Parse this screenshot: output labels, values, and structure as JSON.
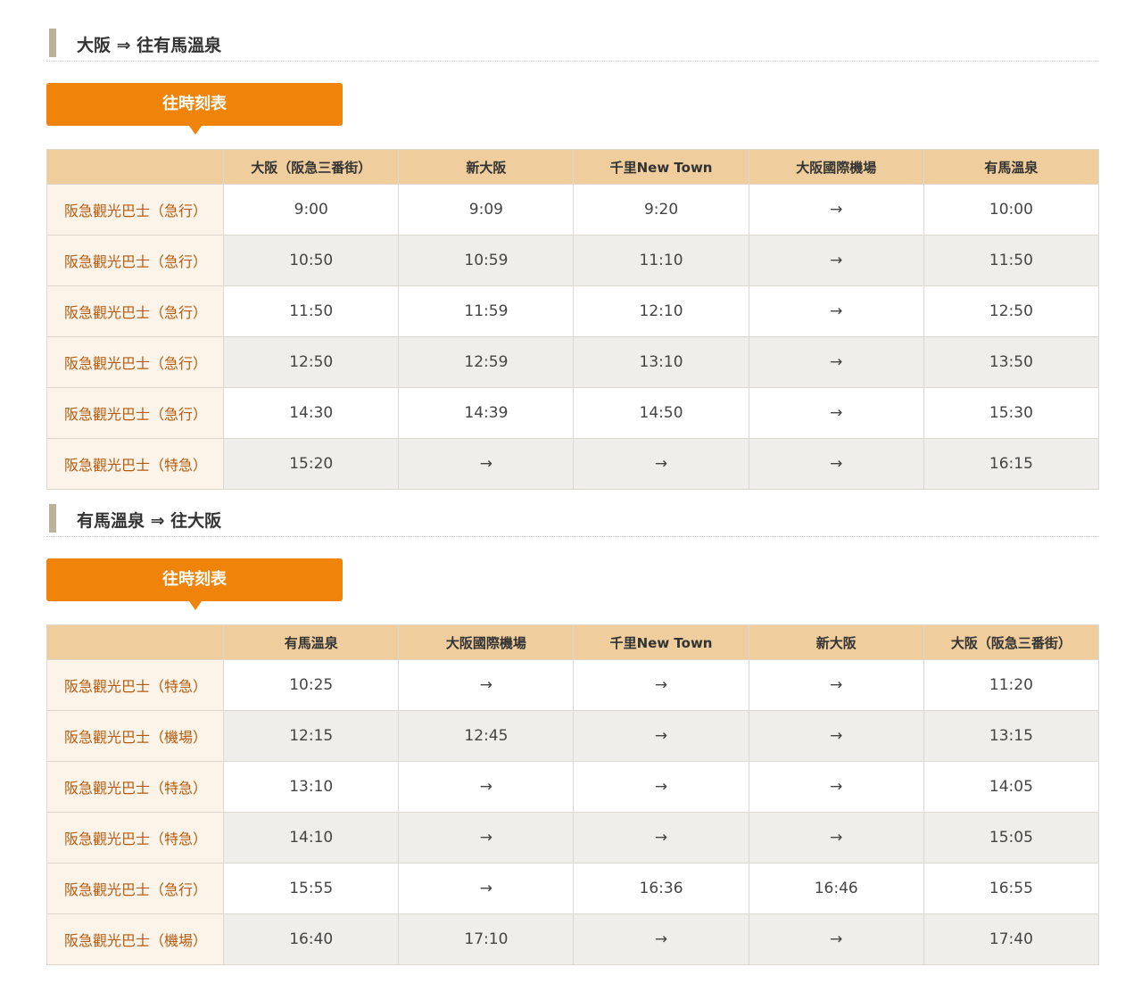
{
  "sections": [
    {
      "title": "大阪 ⇒ 往有馬溫泉",
      "tab_label": "往時刻表",
      "headers": [
        "",
        "大阪（阪急三番街）",
        "新大阪",
        "千里New Town",
        "大阪國際機場",
        "有馬溫泉"
      ],
      "rows": [
        [
          "阪急觀光巴士（急行）",
          "9:00",
          "9:09",
          "9:20",
          "→",
          "10:00"
        ],
        [
          "阪急觀光巴士（急行）",
          "10:50",
          "10:59",
          "11:10",
          "→",
          "11:50"
        ],
        [
          "阪急觀光巴士（急行）",
          "11:50",
          "11:59",
          "12:10",
          "→",
          "12:50"
        ],
        [
          "阪急觀光巴士（急行）",
          "12:50",
          "12:59",
          "13:10",
          "→",
          "13:50"
        ],
        [
          "阪急觀光巴士（急行）",
          "14:30",
          "14:39",
          "14:50",
          "→",
          "15:30"
        ],
        [
          "阪急觀光巴士（特急）",
          "15:20",
          "→",
          "→",
          "→",
          "16:15"
        ]
      ]
    },
    {
      "title": "有馬溫泉 ⇒ 往大阪",
      "tab_label": "往時刻表",
      "headers": [
        "",
        "有馬溫泉",
        "大阪國際機場",
        "千里New Town",
        "新大阪",
        "大阪（阪急三番街）"
      ],
      "rows": [
        [
          "阪急觀光巴士（特急）",
          "10:25",
          "→",
          "→",
          "→",
          "11:20"
        ],
        [
          "阪急觀光巴士（機場）",
          "12:15",
          "12:45",
          "→",
          "→",
          "13:15"
        ],
        [
          "阪急觀光巴士（特急）",
          "13:10",
          "→",
          "→",
          "→",
          "14:05"
        ],
        [
          "阪急觀光巴士（特急）",
          "14:10",
          "→",
          "→",
          "→",
          "15:05"
        ],
        [
          "阪急觀光巴士（急行）",
          "15:55",
          "→",
          "16:36",
          "16:46",
          "16:55"
        ],
        [
          "阪急觀光巴士（機場）",
          "16:40",
          "17:10",
          "→",
          "→",
          "17:40"
        ]
      ]
    }
  ]
}
